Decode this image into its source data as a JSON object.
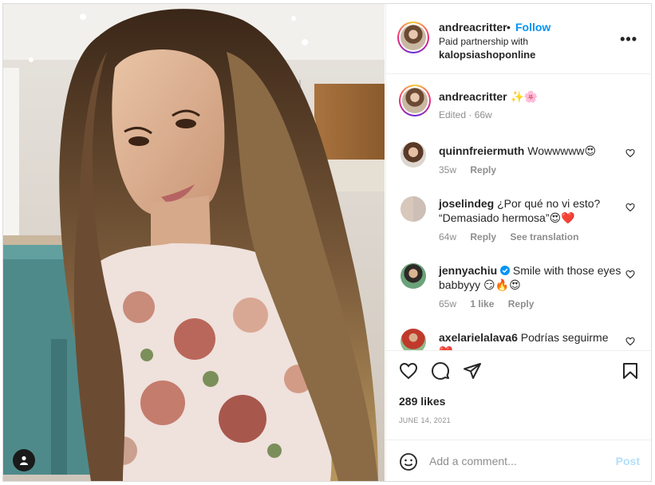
{
  "post": {
    "username": "andreacritter",
    "follow_label": "Follow",
    "paid_text": "Paid partnership with",
    "brand": "kalopsiashoponline",
    "more_icon": "more-horizontal-icon"
  },
  "caption": {
    "username": "andreacritter",
    "emojis": "✨🌸",
    "edited": "Edited",
    "time": "66w"
  },
  "comments": [
    {
      "username": "quinnfreiermuth",
      "text": "Wowwwww",
      "emoji": "😍",
      "time": "35w",
      "reply": "Reply"
    },
    {
      "username": "joselindeg",
      "text": "¿Por qué no vi esto? “Demasiado hermosa”",
      "emoji": "😍❤️",
      "time": "64w",
      "reply": "Reply",
      "extra": "See translation"
    },
    {
      "username": "jennyachiu",
      "verified": true,
      "text": "Smile with those eyes babbyyy",
      "emoji": "😏🔥😍",
      "time": "65w",
      "likes": "1 like",
      "reply": "Reply"
    },
    {
      "username": "axelarielalava6",
      "text": "Podrías seguirme",
      "emoji": "❤️"
    }
  ],
  "actions": {
    "like_icon": "heart-icon",
    "comment_icon": "comment-icon",
    "share_icon": "send-icon",
    "save_icon": "bookmark-icon"
  },
  "likes": "289 likes",
  "date": "JUNE 14, 2021",
  "add_comment": {
    "placeholder": "Add a comment...",
    "post_label": "Post"
  },
  "colors": {
    "accent": "#0095f6",
    "post_disabled": "#b2dffc",
    "muted": "#8e8e8e",
    "text": "#262626"
  }
}
